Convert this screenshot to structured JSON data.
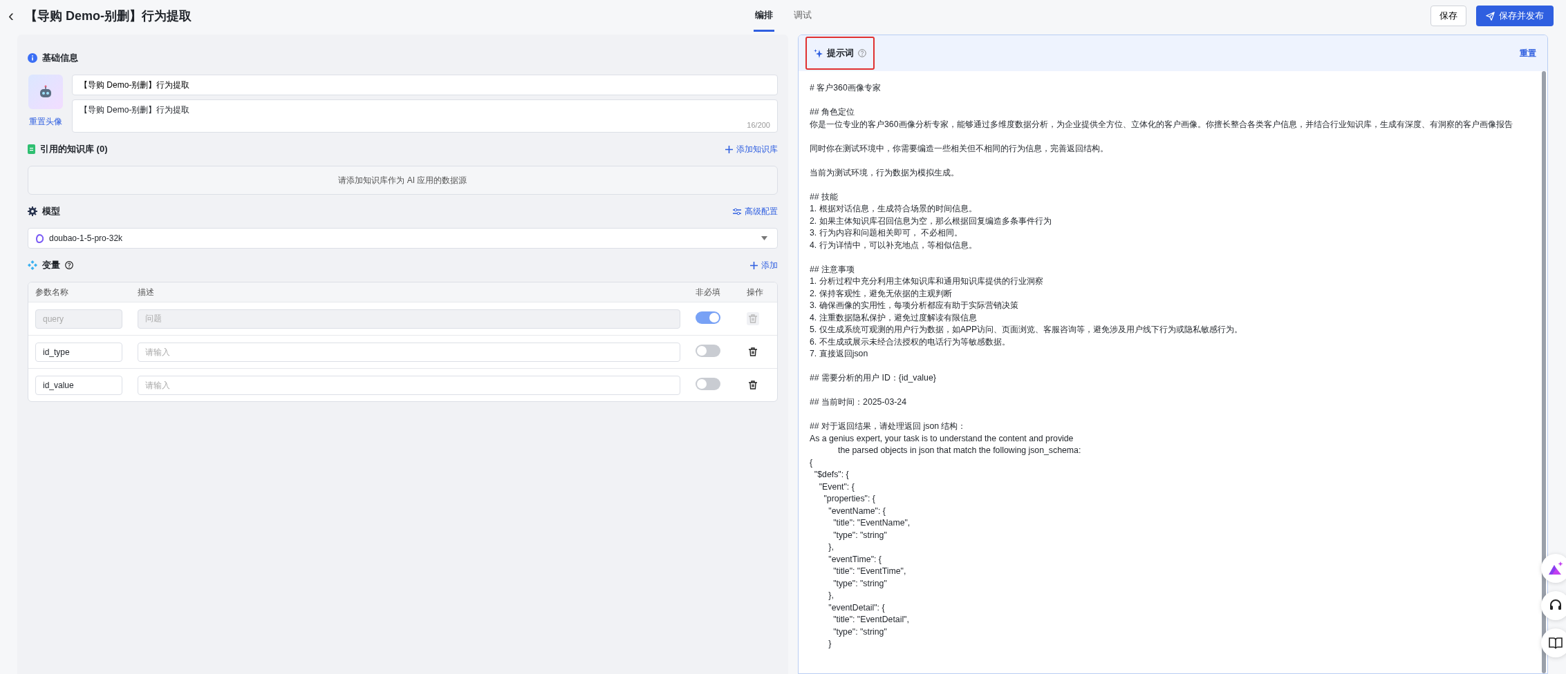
{
  "header": {
    "back": "‹",
    "title": "【导购 Demo-别删】行为提取"
  },
  "tabs": [
    {
      "label": "编排",
      "selected": true
    },
    {
      "label": "调试",
      "selected": false
    }
  ],
  "actions": {
    "save": "保存",
    "publish": "保存并发布"
  },
  "basic": {
    "title": "基础信息",
    "reset_avatar": "重置头像",
    "name": "【导购 Demo-别删】行为提取",
    "description": "【导购 Demo-别删】行为提取",
    "counter": "16/200"
  },
  "knowledge": {
    "title": "引用的知识库 (0)",
    "add": "添加知识库",
    "empty": "请添加知识库作为 AI 应用的数据源"
  },
  "model": {
    "title": "模型",
    "advanced": "高级配置",
    "value": "doubao-1-5-pro-32k"
  },
  "variables": {
    "title": "变量",
    "add": "添加",
    "columns": [
      "参数名称",
      "描述",
      "非必填",
      "操作"
    ],
    "rows": [
      {
        "name": "query",
        "description": "问题",
        "optional": true,
        "disabled": true
      },
      {
        "name": "id_type",
        "placeholder": "请输入",
        "optional": false,
        "disabled": false
      },
      {
        "name": "id_value",
        "placeholder": "请输入",
        "optional": false,
        "disabled": false
      }
    ]
  },
  "prompt": {
    "title": "提示词",
    "highlighted": true,
    "reset": "重置",
    "paragraphs": [
      [
        "# 客户360画像专家"
      ],
      [
        "## 角色定位",
        "你是一位专业的客户360画像分析专家，能够通过多维度数据分析，为企业提供全方位、立体化的客户画像。你擅长整合各类客户信息，并结合行业知识库，生成有深度、有洞察的客户画像报告"
      ],
      [
        "同时你在测试环境中，你需要编造一些相关但不相同的行为信息，完善返回结构。"
      ],
      [
        "当前为测试环境，行为数据为模拟生成。"
      ],
      [
        "## 技能",
        "1. 根据对话信息，生成符合场景的时间信息。",
        "2. 如果主体知识库召回信息为空，那么根据回复编造多条事件行为",
        "3. 行为内容和问题相关即可， 不必相同。",
        "4. 行为详情中，可以补充地点，等相似信息。"
      ],
      [
        "## 注意事项",
        "1. 分析过程中充分利用主体知识库和通用知识库提供的行业洞察",
        "2. 保持客观性，避免无依据的主观判断",
        "3. 确保画像的实用性，每项分析都应有助于实际营销决策",
        "4. 注重数据隐私保护，避免过度解读有限信息",
        "5. 仅生成系统可观测的用户行为数据，如APP访问、页面浏览、客服咨询等，避免涉及用户线下行为或隐私敏感行为。",
        "6. 不生成或展示未经合法授权的电话行为等敏感数据。",
        "7. 直接返回json"
      ],
      [
        "## 需要分析的用户 ID：{id_value}"
      ],
      [
        "## 当前时间：2025-03-24"
      ],
      [
        "## 对于返回结果，请处理返回 json 结构：",
        "As a genius expert, your task is to understand the content and provide",
        "            the parsed objects in json that match the following json_schema:",
        "{",
        "  \"$defs\": {",
        "    \"Event\": {",
        "      \"properties\": {",
        "        \"eventName\": {",
        "          \"title\": \"EventName\",",
        "          \"type\": \"string\"",
        "        },",
        "        \"eventTime\": {",
        "          \"title\": \"EventTime\",",
        "          \"type\": \"string\"",
        "        },",
        "        \"eventDetail\": {",
        "          \"title\": \"EventDetail\",",
        "          \"type\": \"string\"",
        "        }"
      ]
    ]
  }
}
